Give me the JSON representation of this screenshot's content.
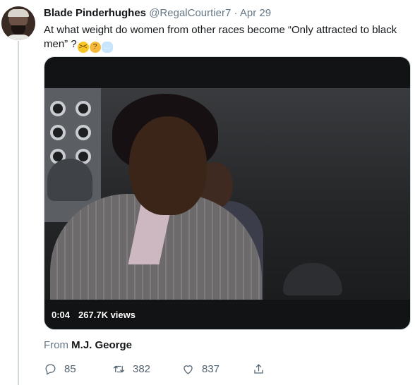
{
  "tweet": {
    "author_name": "Blade Pinderhughes",
    "author_handle": "@RegalCourtier7",
    "separator": "·",
    "date": "Apr 29",
    "text": "At what weight do women from other races become “Only attracted to black men” ?",
    "emoji": [
      "weary-face",
      "thinking-face",
      "thought-balloon"
    ]
  },
  "video": {
    "duration": "0:04",
    "views": "267.7K views"
  },
  "attribution": {
    "prefix": "From",
    "source": "M.J. George"
  },
  "actions": {
    "reply_count": "85",
    "retweet_count": "382",
    "like_count": "837"
  },
  "colors": {
    "text_primary": "#14171a",
    "text_secondary": "#657786",
    "divider": "#cfd9de"
  }
}
